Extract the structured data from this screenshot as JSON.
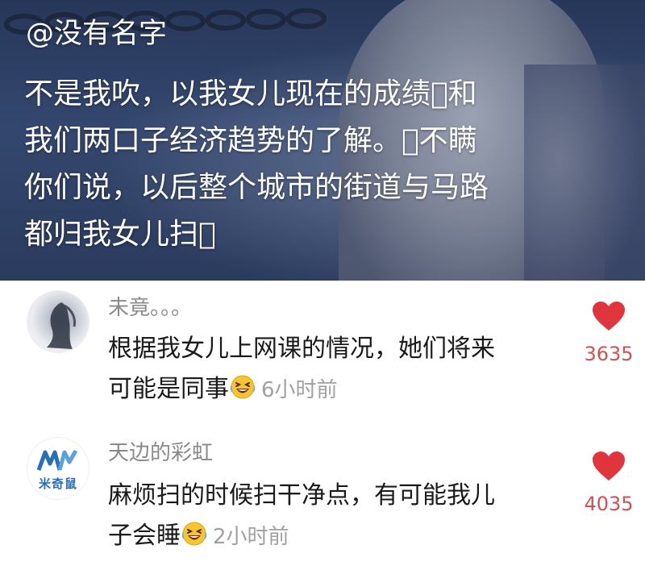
{
  "post": {
    "username": "@没有名字",
    "lines": [
      "不是我吹，以我女儿现在的成绩􀀀和",
      "我们两口子经济趋势的了解。􀀀不瞒",
      "你们说，以后整个城市的街道与马路",
      "都归我女儿扫􀀀"
    ]
  },
  "comments": [
    {
      "name": "未竟。。。",
      "text_line1": "根据我女儿上网课的情况，她们将来",
      "text_line2": "可能是同事",
      "emoji": "laughing-tears-emoji",
      "time": "6小时前",
      "likes": "3635"
    },
    {
      "name": "天边的彩虹",
      "avatar_text": "米奇鼠",
      "text_line1": "麻烦扫的时候扫干净点，有可能我儿",
      "text_line2": "子会睡",
      "emoji": "laughing-tears-emoji",
      "time": "2小时前",
      "likes": "4035"
    }
  ],
  "colors": {
    "like_red": "#d05151",
    "heart_fill": "#e0353d",
    "name_gray": "#8a8a8a",
    "time_gray": "#a0a0a0"
  },
  "icons": {
    "like": "heart-icon",
    "emoji": "laughing-tears-emoji"
  }
}
